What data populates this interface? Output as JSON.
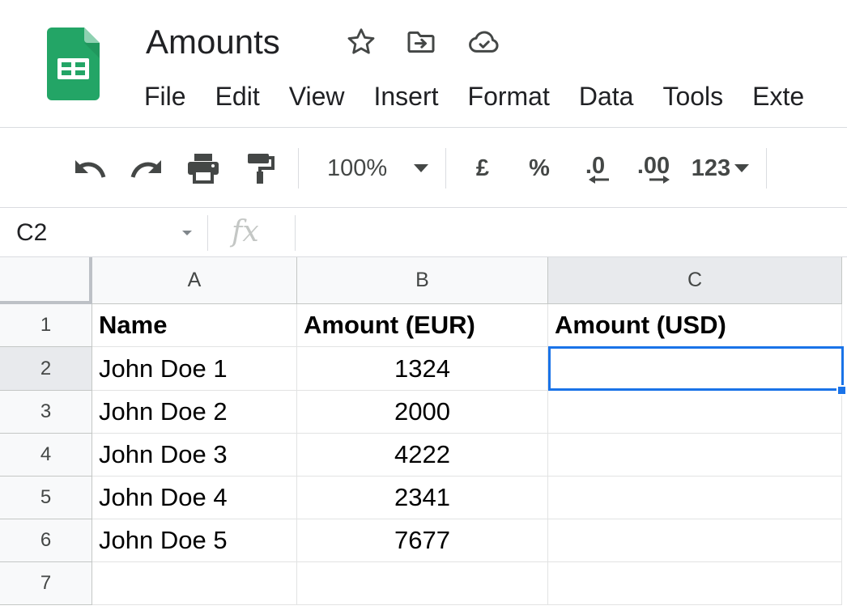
{
  "app": {
    "title": "Amounts",
    "colors": {
      "sheets_green": "#23a566",
      "selection_blue": "#1a73e8"
    },
    "title_icons": [
      "star-icon",
      "move-to-folder-icon",
      "cloud-saved-icon"
    ]
  },
  "menu": {
    "items": [
      {
        "label": "File"
      },
      {
        "label": "Edit"
      },
      {
        "label": "View"
      },
      {
        "label": "Insert"
      },
      {
        "label": "Format"
      },
      {
        "label": "Data"
      },
      {
        "label": "Tools"
      },
      {
        "label": "Exte"
      }
    ]
  },
  "toolbar": {
    "icons": [
      "undo-icon",
      "redo-icon",
      "print-icon",
      "paint-format-icon"
    ],
    "zoom": "100%",
    "currency": "£",
    "percent": "%",
    "decrease_decimal": ".0",
    "increase_decimal": ".00",
    "number_format": "123"
  },
  "formula_bar": {
    "name_box": "C2",
    "fx": "fx",
    "formula": ""
  },
  "grid": {
    "columns": [
      "A",
      "B",
      "C"
    ],
    "rows": [
      "1",
      "2",
      "3",
      "4",
      "5",
      "6",
      "7"
    ],
    "header_row": [
      "Name",
      "Amount (EUR)",
      "Amount (USD)"
    ],
    "data_rows": [
      [
        "John Doe 1",
        "1324",
        ""
      ],
      [
        "John Doe 2",
        "2000",
        ""
      ],
      [
        "John Doe 3",
        "4222",
        ""
      ],
      [
        "John Doe 4",
        "2341",
        ""
      ],
      [
        "John Doe 5",
        "7677",
        ""
      ],
      [
        "",
        "",
        ""
      ]
    ],
    "selected_cell": "C2"
  }
}
